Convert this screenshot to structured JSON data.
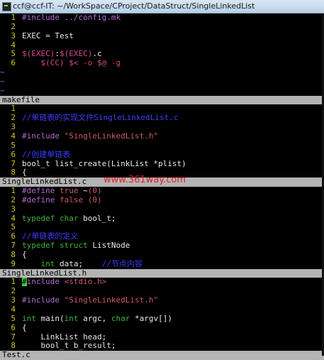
{
  "window": {
    "title": "ccf@ccf-IT: ~/WorkSpace/CProject/DataStruct/SingleLinkedList"
  },
  "panes": [
    {
      "name": "makefile",
      "lines": [
        {
          "n": "1",
          "segs": [
            {
              "t": "#include ../config.mk",
              "c": "pre"
            }
          ]
        },
        {
          "n": "2",
          "segs": []
        },
        {
          "n": "3",
          "segs": [
            {
              "t": "EXEC = Test",
              "c": "pl"
            }
          ]
        },
        {
          "n": "4",
          "segs": []
        },
        {
          "n": "5",
          "segs": [
            {
              "t": "$(EXEC)",
              "c": "var"
            },
            {
              "t": ":",
              "c": "pl"
            },
            {
              "t": "$(EXEC)",
              "c": "var"
            },
            {
              "t": ".c",
              "c": "pl"
            }
          ]
        },
        {
          "n": "6",
          "segs": [
            {
              "t": "    ",
              "c": "pl"
            },
            {
              "t": "$(CC)",
              "c": "var"
            },
            {
              "t": " ",
              "c": "pl"
            },
            {
              "t": "$<",
              "c": "var"
            },
            {
              "t": " ",
              "c": "pl"
            },
            {
              "t": "-o",
              "c": "red"
            },
            {
              "t": " ",
              "c": "pl"
            },
            {
              "t": "$@",
              "c": "var"
            },
            {
              "t": " ",
              "c": "pl"
            },
            {
              "t": "-g",
              "c": "red"
            }
          ]
        }
      ],
      "tildes": 3,
      "status": "makefile"
    },
    {
      "name": "SingleLinkedList.c",
      "lines": [
        {
          "n": "1",
          "segs": []
        },
        {
          "n": "2",
          "segs": [
            {
              "t": "//单链表的实现文件SingleLinkedList.c",
              "c": "com"
            }
          ]
        },
        {
          "n": "3",
          "segs": []
        },
        {
          "n": "4",
          "segs": [
            {
              "t": "#include ",
              "c": "pre"
            },
            {
              "t": "\"SingleLinkedList.h\"",
              "c": "str"
            }
          ]
        },
        {
          "n": "5",
          "segs": []
        },
        {
          "n": "6",
          "segs": [
            {
              "t": "//创建单链表",
              "c": "com"
            }
          ]
        },
        {
          "n": "7",
          "segs": [
            {
              "t": "bool_t list_create(LinkList *plist)",
              "c": "pl"
            }
          ]
        },
        {
          "n": "8",
          "segs": [
            {
              "t": "{",
              "c": "pl"
            }
          ]
        }
      ],
      "status": "SingleLinkedList.c"
    },
    {
      "name": "SingleLinkedList.h",
      "lines": [
        {
          "n": "1",
          "segs": [
            {
              "t": "#define ",
              "c": "pre"
            },
            {
              "t": "true",
              "c": "str"
            },
            {
              "t": " ~",
              "c": "pl"
            },
            {
              "t": "(0)",
              "c": "str"
            }
          ]
        },
        {
          "n": "2",
          "segs": [
            {
              "t": "#define ",
              "c": "pre"
            },
            {
              "t": "false",
              "c": "str"
            },
            {
              "t": " ",
              "c": "pl"
            },
            {
              "t": "(0)",
              "c": "str"
            }
          ]
        },
        {
          "n": "3",
          "segs": []
        },
        {
          "n": "4",
          "segs": [
            {
              "t": "typedef",
              "c": "kw"
            },
            {
              "t": " ",
              "c": "pl"
            },
            {
              "t": "char",
              "c": "kw"
            },
            {
              "t": " bool_t;",
              "c": "pl"
            }
          ]
        },
        {
          "n": "5",
          "segs": []
        },
        {
          "n": "6",
          "segs": [
            {
              "t": "//单链表的定义",
              "c": "com"
            }
          ]
        },
        {
          "n": "7",
          "segs": [
            {
              "t": "typedef",
              "c": "kw"
            },
            {
              "t": " ",
              "c": "pl"
            },
            {
              "t": "struct",
              "c": "kw"
            },
            {
              "t": " ListNode",
              "c": "pl"
            }
          ]
        },
        {
          "n": "8",
          "segs": [
            {
              "t": "{",
              "c": "pl"
            }
          ]
        },
        {
          "n": "9",
          "segs": [
            {
              "t": "    ",
              "c": "pl"
            },
            {
              "t": "int",
              "c": "kw"
            },
            {
              "t": " data;    ",
              "c": "pl"
            },
            {
              "t": "//节点内容",
              "c": "com"
            }
          ]
        }
      ],
      "status": "SingleLinkedList.h"
    },
    {
      "name": "Test.c",
      "lines": [
        {
          "n": "1",
          "segs": [
            {
              "t": "#",
              "c": "cursor"
            },
            {
              "t": "include ",
              "c": "pre"
            },
            {
              "t": "<stdio.h>",
              "c": "str"
            }
          ]
        },
        {
          "n": "2",
          "segs": []
        },
        {
          "n": "3",
          "segs": [
            {
              "t": "#include ",
              "c": "pre"
            },
            {
              "t": "\"SingleLinkedList.h\"",
              "c": "str"
            }
          ]
        },
        {
          "n": "4",
          "segs": []
        },
        {
          "n": "5",
          "segs": [
            {
              "t": "int",
              "c": "kw"
            },
            {
              "t": " main(",
              "c": "pl"
            },
            {
              "t": "int",
              "c": "kw"
            },
            {
              "t": " argc, ",
              "c": "pl"
            },
            {
              "t": "char",
              "c": "kw"
            },
            {
              "t": " *argv[])",
              "c": "pl"
            }
          ]
        },
        {
          "n": "6",
          "segs": [
            {
              "t": "{",
              "c": "pl"
            }
          ]
        },
        {
          "n": "7",
          "segs": [
            {
              "t": "    LinkList head;",
              "c": "pl"
            }
          ]
        },
        {
          "n": "8",
          "segs": [
            {
              "t": "    bool_t b_result;",
              "c": "pl"
            }
          ]
        }
      ],
      "status": "Test.c"
    }
  ],
  "watermark": "www.361way.com"
}
